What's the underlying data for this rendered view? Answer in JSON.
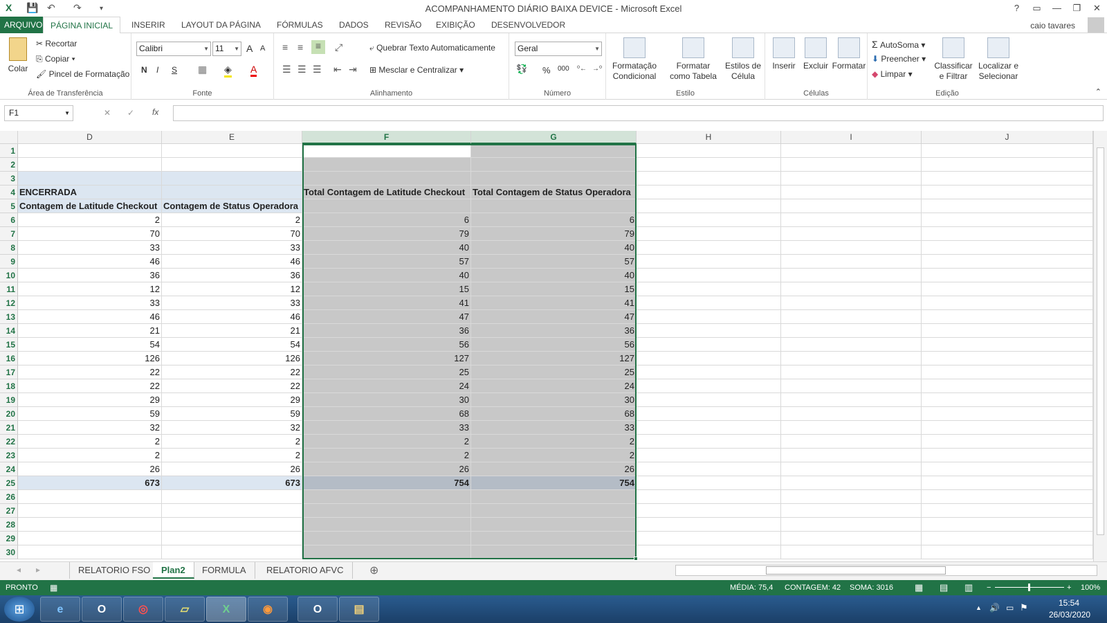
{
  "window": {
    "title": "ACOMPANHAMENTO DIÁRIO BAIXA DEVICE - Microsoft Excel",
    "help": "?",
    "minimize": "—",
    "restore": "❐",
    "close": "✕",
    "restore_ribbon": "▭"
  },
  "quick_access": {
    "excel": "X",
    "save": "💾",
    "undo": "↶",
    "redo": "↷",
    "more": "▾"
  },
  "tabs": [
    "ARQUIVO",
    "PÁGINA INICIAL",
    "INSERIR",
    "LAYOUT DA PÁGINA",
    "FÓRMULAS",
    "DADOS",
    "REVISÃO",
    "EXIBIÇÃO",
    "DESENVOLVEDOR"
  ],
  "user": "caio tavares",
  "ribbon": {
    "clipboard": {
      "paste": "Colar",
      "cut": "Recortar",
      "copy": "Copiar",
      "painter": "Pincel de Formatação",
      "label": "Área de Transferência"
    },
    "font": {
      "name": "Calibri",
      "size": "11",
      "grow": "A",
      "shrink": "A",
      "bold": "N",
      "italic": "I",
      "underline": "S",
      "label": "Fonte"
    },
    "alignment": {
      "wrap": "Quebrar Texto Automaticamente",
      "merge": "Mesclar e Centralizar",
      "label": "Alinhamento"
    },
    "number": {
      "format": "Geral",
      "percent": "%",
      "thousands": "000",
      "label": "Número"
    },
    "styles": {
      "conditional": "Formatação Condicional",
      "table": "Formatar como Tabela",
      "cell": "Estilos de Célula",
      "label": "Estilo"
    },
    "cells": {
      "insert": "Inserir",
      "delete": "Excluir",
      "format": "Formatar",
      "label": "Células"
    },
    "editing": {
      "autosum": "AutoSoma",
      "fill": "Preencher",
      "clear": "Limpar",
      "sort": "Classificar e Filtrar",
      "find": "Localizar e Selecionar",
      "label": "Edição"
    }
  },
  "formula_bar": {
    "name_box": "F1",
    "cancel": "✕",
    "enter": "✓",
    "fx": "fx",
    "value": ""
  },
  "columns": [
    "D",
    "E",
    "F",
    "G",
    "H",
    "I",
    "J"
  ],
  "rows": [
    "1",
    "2",
    "3",
    "4",
    "5",
    "6",
    "7",
    "8",
    "9",
    "10",
    "11",
    "12",
    "13",
    "14",
    "15",
    "16",
    "17",
    "18",
    "19",
    "20",
    "21",
    "22",
    "23",
    "24",
    "25",
    "26",
    "27",
    "28",
    "29",
    "30"
  ],
  "headers": {
    "d4": "ENCERRADA",
    "d5": "Contagem de Latitude Checkout",
    "e5": "Contagem de Status Operadora",
    "f4": "Total Contagem de Latitude Checkout",
    "g4": "Total Contagem de Status Operadora"
  },
  "table": [
    [
      "2",
      "2",
      "6",
      "6"
    ],
    [
      "70",
      "70",
      "79",
      "79"
    ],
    [
      "33",
      "33",
      "40",
      "40"
    ],
    [
      "46",
      "46",
      "57",
      "57"
    ],
    [
      "36",
      "36",
      "40",
      "40"
    ],
    [
      "12",
      "12",
      "15",
      "15"
    ],
    [
      "33",
      "33",
      "41",
      "41"
    ],
    [
      "46",
      "46",
      "47",
      "47"
    ],
    [
      "21",
      "21",
      "36",
      "36"
    ],
    [
      "54",
      "54",
      "56",
      "56"
    ],
    [
      "126",
      "126",
      "127",
      "127"
    ],
    [
      "22",
      "22",
      "25",
      "25"
    ],
    [
      "22",
      "22",
      "24",
      "24"
    ],
    [
      "29",
      "29",
      "30",
      "30"
    ],
    [
      "59",
      "59",
      "68",
      "68"
    ],
    [
      "32",
      "32",
      "33",
      "33"
    ],
    [
      "2",
      "2",
      "2",
      "2"
    ],
    [
      "2",
      "2",
      "2",
      "2"
    ],
    [
      "26",
      "26",
      "26",
      "26"
    ]
  ],
  "totals": [
    "673",
    "673",
    "754",
    "754"
  ],
  "sheets": [
    "RELATORIO FSO",
    "Plan2",
    "FORMULA",
    "RELATORIO AFVC"
  ],
  "add_sheet": "⊕",
  "status": {
    "mode": "PRONTO",
    "average": "MÉDIA: 75,4",
    "count": "CONTAGEM: 42",
    "sum": "SOMA: 3016",
    "zoom": "100%",
    "zoom_minus": "−",
    "zoom_plus": "+"
  },
  "taskbar": {
    "time": "15:54",
    "date": "26/03/2020",
    "apps": [
      "e",
      "O",
      "◎",
      "▱",
      "X",
      "◉",
      "O",
      "▤"
    ],
    "start": "⊞",
    "flag": "⚑",
    "speaker": "🔊",
    "up": "▲"
  },
  "colors": {
    "excel_green": "#217346",
    "selection_gray": "#c8c8c8",
    "total_blue": "#dce6f1",
    "selection_total": "#b4bcc6"
  }
}
